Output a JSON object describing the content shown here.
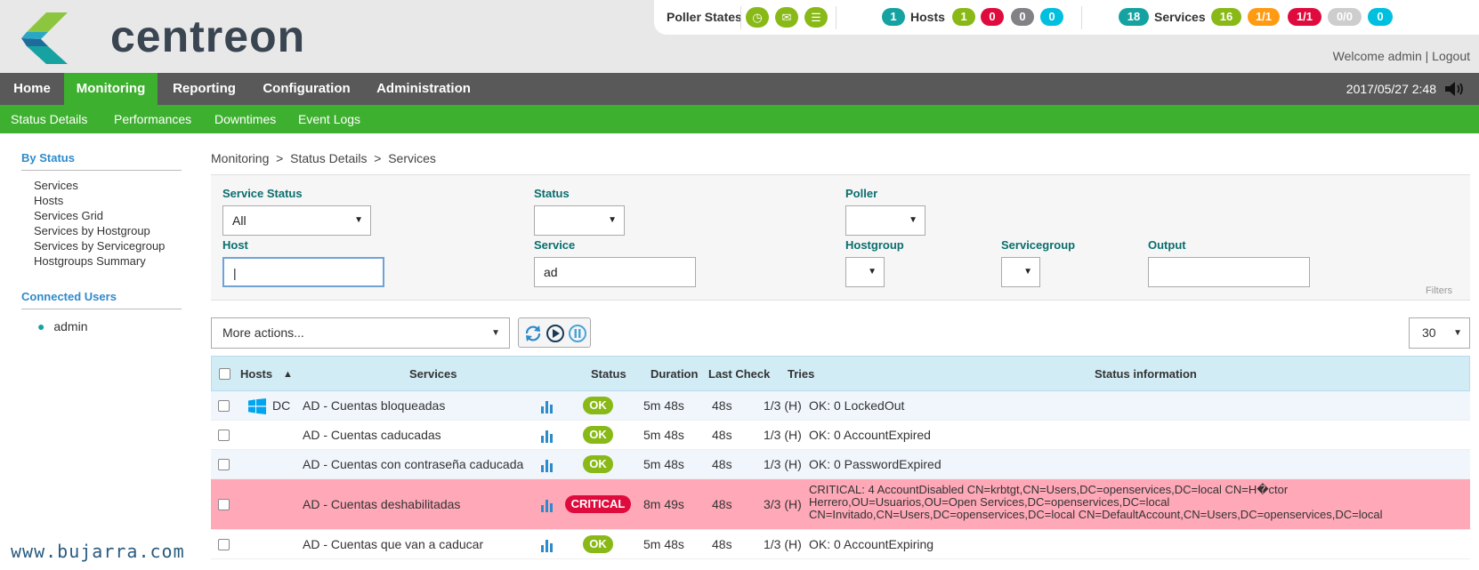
{
  "header": {
    "logo_text": "centreon",
    "poller_label": "Poller States",
    "hosts_label": "Hosts",
    "services_label": "Services",
    "hosts_counts": [
      "1",
      "1",
      "0",
      "0",
      "0"
    ],
    "services_counts": [
      "18",
      "16",
      "1/1",
      "1/1",
      "0/0",
      "0"
    ],
    "welcome": "Welcome admin | Logout",
    "clock": "2017/05/27 2:48"
  },
  "mainnav": [
    "Home",
    "Monitoring",
    "Reporting",
    "Configuration",
    "Administration"
  ],
  "subnav": [
    "Status  Details",
    "Performances",
    "Downtimes",
    "Event  Logs"
  ],
  "sidebar": {
    "by_status": "By Status",
    "items": [
      "Services",
      "Hosts",
      "Services Grid",
      "Services by Hostgroup",
      "Services by Servicegroup",
      "Hostgroups Summary"
    ],
    "connected": "Connected Users",
    "user": "admin"
  },
  "breadcrumb": "Monitoring  >  Status Details  >  Services",
  "filters": {
    "service_status_label": "Service Status",
    "service_status_value": "All",
    "status_label": "Status",
    "poller_label": "Poller",
    "host_label": "Host",
    "host_value": "|",
    "service_label": "Service",
    "service_value": "ad",
    "hostgroup_label": "Hostgroup",
    "servicegroup_label": "Servicegroup",
    "output_label": "Output",
    "filters_word": "Filters"
  },
  "actions": {
    "more": "More actions...",
    "per_page": "30"
  },
  "table": {
    "headers": [
      "Hosts",
      "Services",
      "Status",
      "Duration",
      "Last Check",
      "Tries",
      "Status information"
    ],
    "rows": [
      {
        "host": "DC",
        "service": "AD - Cuentas bloqueadas",
        "status": "OK",
        "duration": "5m 48s",
        "last": "48s",
        "tries": "1/3 (H)",
        "info": "OK: 0 LockedOut"
      },
      {
        "host": "",
        "service": "AD - Cuentas caducadas",
        "status": "OK",
        "duration": "5m 48s",
        "last": "48s",
        "tries": "1/3 (H)",
        "info": "OK: 0 AccountExpired"
      },
      {
        "host": "",
        "service": "AD - Cuentas con contraseña caducada",
        "status": "OK",
        "duration": "5m 48s",
        "last": "48s",
        "tries": "1/3 (H)",
        "info": "OK: 0 PasswordExpired"
      },
      {
        "host": "",
        "service": "AD - Cuentas deshabilitadas",
        "status": "CRITICAL",
        "duration": "8m 49s",
        "last": "48s",
        "tries": "3/3 (H)",
        "info1": "CRITICAL: 4 AccountDisabled CN=krbtgt,CN=Users,DC=openservices,DC=local CN=H�ctor",
        "info2": "Herrero,OU=Usuarios,OU=Open Services,DC=openservices,DC=local",
        "info3": "CN=Invitado,CN=Users,DC=openservices,DC=local CN=DefaultAccount,CN=Users,DC=openservices,DC=local"
      },
      {
        "host": "",
        "service": "AD - Cuentas que van a caducar",
        "status": "OK",
        "duration": "5m 48s",
        "last": "48s",
        "tries": "1/3 (H)",
        "info": "OK: 0 AccountExpiring"
      }
    ]
  },
  "watermark": "www.bujarra.com"
}
